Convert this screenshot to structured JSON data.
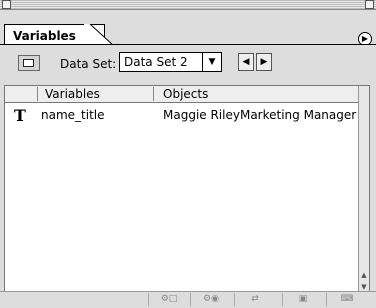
{
  "panel": {
    "tab_label": "Variables",
    "menu_icon": "panel-menu-icon"
  },
  "toolbar": {
    "data_set_label": "Data Set:",
    "data_set_value": "Data Set 2",
    "prev_icon": "◀",
    "next_icon": "▶"
  },
  "table": {
    "columns": [
      "Variables",
      "Objects"
    ],
    "rows": [
      {
        "type_icon": "T",
        "name": "name_title",
        "object": "Maggie RileyMarketing Manager"
      }
    ]
  }
}
